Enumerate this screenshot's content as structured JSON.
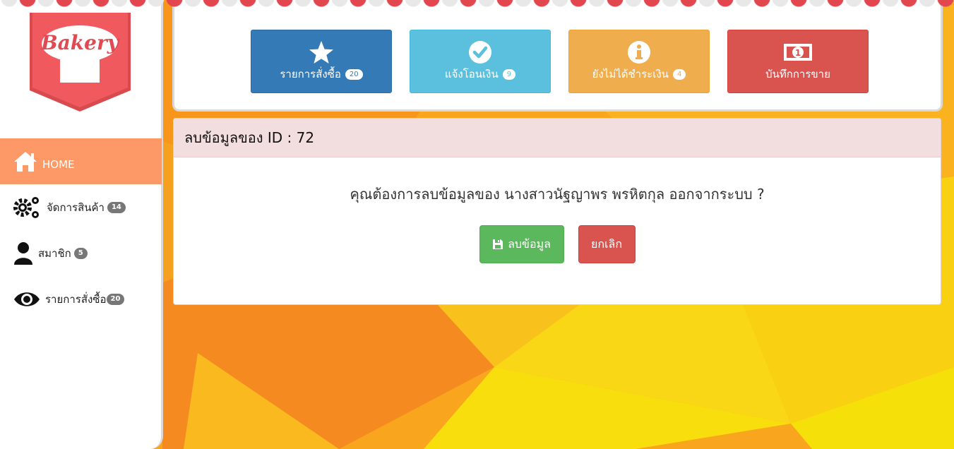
{
  "logo": {
    "text": "Bakery"
  },
  "sidebar": {
    "items": [
      {
        "label": "HOME",
        "icon": "home-icon",
        "badge": ""
      },
      {
        "label": "จัดการสินค้า",
        "icon": "gears-icon",
        "badge": "14"
      },
      {
        "label": "สมาชิก",
        "icon": "user-icon",
        "badge": "5"
      },
      {
        "label": "รายการสั่งซื้อ",
        "icon": "eye-icon",
        "badge": "20"
      }
    ]
  },
  "tiles": [
    {
      "label": "รายการสั่งซื้อ",
      "badge": "20",
      "icon": "star-icon",
      "color": "#337ab7"
    },
    {
      "label": "แจ้งโอนเงิน",
      "badge": "9",
      "icon": "check-circle-icon",
      "color": "#5bc0de"
    },
    {
      "label": "ยังไม่ได้ชำระเงิน",
      "badge": "4",
      "icon": "info-circle-icon",
      "color": "#f0ad4e"
    },
    {
      "label": "บันทึกการขาย",
      "badge": "",
      "icon": "money-icon",
      "color": "#d9534f"
    }
  ],
  "delete_panel": {
    "title": "ลบข้อมูลของ ID : 72",
    "message": "คุณต้องการลบข้อมูลของ นางสาวนัฐญาพร พรหิตกุล ออกจากระบบ ?",
    "confirm_label": "ลบข้อมูล",
    "cancel_label": "ยกเลิก"
  },
  "colors": {
    "accent": "#fd9966",
    "background": "#f7a81c",
    "panel_header": "#f2dede"
  }
}
